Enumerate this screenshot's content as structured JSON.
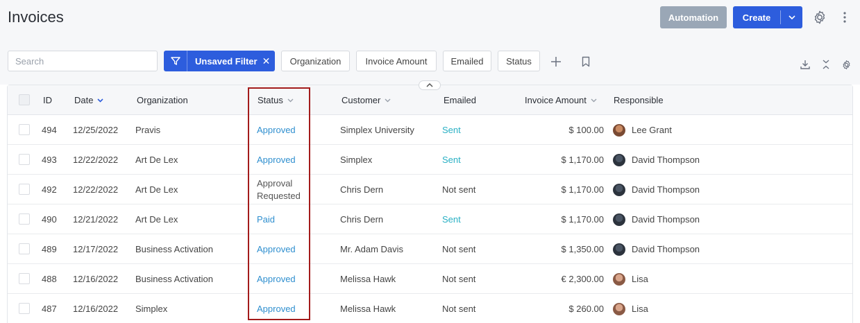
{
  "header": {
    "title": "Invoices",
    "automation_label": "Automation",
    "create_label": "Create"
  },
  "toolbar": {
    "search_placeholder": "Search",
    "filter_label": "Unsaved Filter",
    "filter_close": "✕",
    "chips": [
      "Organization",
      "Invoice Amount",
      "Emailed",
      "Status"
    ]
  },
  "table": {
    "columns": {
      "id": "ID",
      "date": "Date",
      "organization": "Organization",
      "status": "Status",
      "customer": "Customer",
      "emailed": "Emailed",
      "amount": "Invoice Amount",
      "responsible": "Responsible"
    },
    "rows": [
      {
        "id": "494",
        "date": "12/25/2022",
        "organization": "Pravis",
        "status": "Approved",
        "customer": "Simplex University",
        "emailed": "Sent",
        "amount": "$ 100.00",
        "responsible": "Lee Grant"
      },
      {
        "id": "493",
        "date": "12/22/2022",
        "organization": "Art De Lex",
        "status": "Approved",
        "customer": "Simplex",
        "emailed": "Sent",
        "amount": "$ 1,170.00",
        "responsible": "David Thompson"
      },
      {
        "id": "492",
        "date": "12/22/2022",
        "organization": "Art De Lex",
        "status": "Approval Requested",
        "customer": "Chris Dern",
        "emailed": "Not sent",
        "amount": "$ 1,170.00",
        "responsible": "David Thompson"
      },
      {
        "id": "490",
        "date": "12/21/2022",
        "organization": "Art De Lex",
        "status": "Paid",
        "customer": "Chris Dern",
        "emailed": "Sent",
        "amount": "$ 1,170.00",
        "responsible": "David Thompson"
      },
      {
        "id": "489",
        "date": "12/17/2022",
        "organization": "Business Activation",
        "status": "Approved",
        "customer": "Mr. Adam Davis",
        "emailed": "Not sent",
        "amount": "$ 1,350.00",
        "responsible": "David Thompson"
      },
      {
        "id": "488",
        "date": "12/16/2022",
        "organization": "Business Activation",
        "status": "Approved",
        "customer": "Melissa Hawk",
        "emailed": "Not sent",
        "amount": "€ 2,300.00",
        "responsible": "Lisa"
      },
      {
        "id": "487",
        "date": "12/16/2022",
        "organization": "Simplex",
        "status": "Approved",
        "customer": "Melissa Hawk",
        "emailed": "Not sent",
        "amount": "$ 260.00",
        "responsible": "Lisa"
      }
    ]
  },
  "colors": {
    "primary": "#2d5ddd",
    "automation": "#9aa7b6",
    "status_link": "#2f8fcf",
    "sent": "#29b0c4",
    "highlight": "#a31b1b"
  }
}
